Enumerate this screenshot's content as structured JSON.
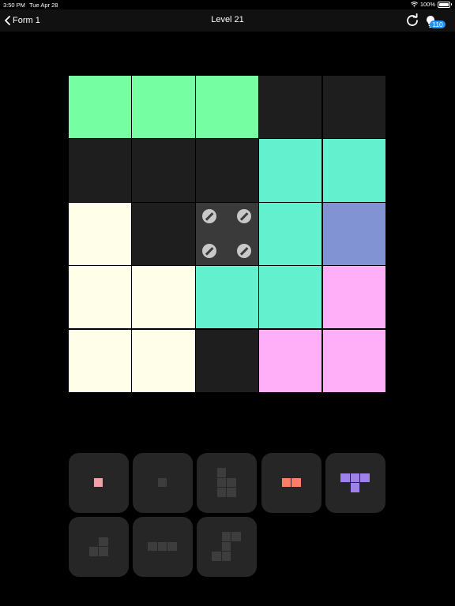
{
  "status_bar": {
    "time": "3:50 PM",
    "date": "Tue Apr 28",
    "battery": "100%",
    "battery_level": 1.0,
    "icons": [
      "wifi-icon",
      "battery-icon"
    ]
  },
  "nav": {
    "back_label": "Form 1",
    "title": "Level 21",
    "refresh_icon": "refresh-icon",
    "hint_icon": "lightbulb-icon",
    "hint_count": "110"
  },
  "colors": {
    "empty": "#1e1e1e",
    "green": "#75fea2",
    "teal": "#62f0cf",
    "cream": "#fffee8",
    "blue": "#8193d3",
    "pink": "#ffaff8",
    "blocked": "#3a3a3a",
    "grid_line": "#000000",
    "tray_bg": "#262626",
    "tray_piece_dim": "#3d3d3d",
    "tray_pink": "#f4a0a8",
    "tray_orange": "#ff7f66",
    "tray_purple": "#9e82ea"
  },
  "board": {
    "rows": 5,
    "cols": 5,
    "cells": [
      [
        "green",
        "green",
        "green",
        "empty",
        "empty"
      ],
      [
        "empty",
        "empty",
        "empty",
        "teal",
        "teal"
      ],
      [
        "cream",
        "empty",
        "blocked",
        "teal",
        "blue"
      ],
      [
        "cream",
        "cream",
        "teal",
        "teal",
        "pink"
      ],
      [
        "cream",
        "cream",
        "empty",
        "pink",
        "pink"
      ]
    ]
  },
  "pieces": [
    {
      "name": "piece-single-pink",
      "color": "tray_pink",
      "shape": [
        [
          0,
          0
        ]
      ]
    },
    {
      "name": "piece-single-dim",
      "color": "tray_piece_dim",
      "shape": [
        [
          0,
          0
        ]
      ]
    },
    {
      "name": "piece-l-dim",
      "color": "tray_piece_dim",
      "shape": [
        [
          0,
          0
        ],
        [
          1,
          0
        ],
        [
          1,
          1
        ],
        [
          2,
          0
        ],
        [
          2,
          1
        ]
      ]
    },
    {
      "name": "piece-domino-orange",
      "color": "tray_orange",
      "shape": [
        [
          0,
          0
        ],
        [
          0,
          1
        ]
      ]
    },
    {
      "name": "piece-t-purple",
      "color": "tray_purple",
      "shape": [
        [
          0,
          0
        ],
        [
          0,
          1
        ],
        [
          0,
          2
        ],
        [
          1,
          1
        ]
      ]
    },
    {
      "name": "piece-j-dim",
      "color": "tray_piece_dim",
      "shape": [
        [
          0,
          1
        ],
        [
          1,
          0
        ],
        [
          1,
          1
        ]
      ]
    },
    {
      "name": "piece-line3-dim",
      "color": "tray_piece_dim",
      "shape": [
        [
          0,
          0
        ],
        [
          0,
          1
        ],
        [
          0,
          2
        ]
      ]
    },
    {
      "name": "piece-s-dim",
      "color": "tray_piece_dim",
      "shape": [
        [
          0,
          1
        ],
        [
          0,
          2
        ],
        [
          1,
          1
        ],
        [
          2,
          0
        ],
        [
          2,
          1
        ]
      ]
    }
  ]
}
